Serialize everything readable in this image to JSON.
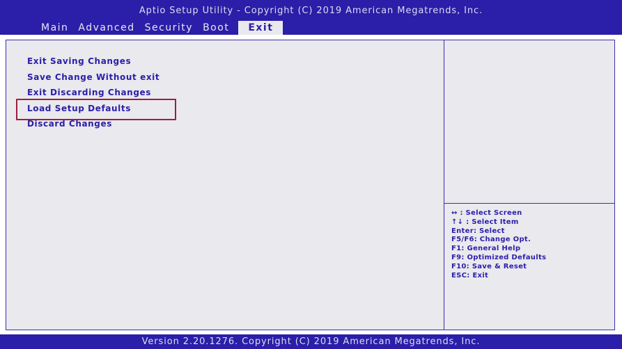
{
  "header": {
    "title": "Aptio Setup Utility - Copyright (C) 2019 American Megatrends, Inc.",
    "tabs": [
      {
        "label": "Main"
      },
      {
        "label": "Advanced"
      },
      {
        "label": "Security"
      },
      {
        "label": "Boot"
      },
      {
        "label": "Exit"
      }
    ],
    "active_tab": "Exit"
  },
  "exit_menu": {
    "items": [
      {
        "label": "Exit Saving Changes"
      },
      {
        "label": "Save Change Without exit"
      },
      {
        "label": "Exit Discarding Changes"
      },
      {
        "label": "Load Setup Defaults"
      },
      {
        "label": "Discard Changes"
      }
    ],
    "highlighted_item": "Load Setup Defaults"
  },
  "help": {
    "lines": [
      "↔ : Select Screen",
      "↑↓ : Select Item",
      "Enter: Select",
      "F5/F6: Change Opt.",
      "F1: General Help",
      "F9: Optimized Defaults",
      "F10: Save & Reset",
      "ESC: Exit"
    ]
  },
  "footer": {
    "text": "Version 2.20.1276. Copyright (C) 2019 American Megatrends, Inc."
  },
  "colors": {
    "bar": "#2b1ea8",
    "panel": "#e9e9ee",
    "text": "#2b1ea8",
    "highlight_border": "#9c1f3c"
  }
}
